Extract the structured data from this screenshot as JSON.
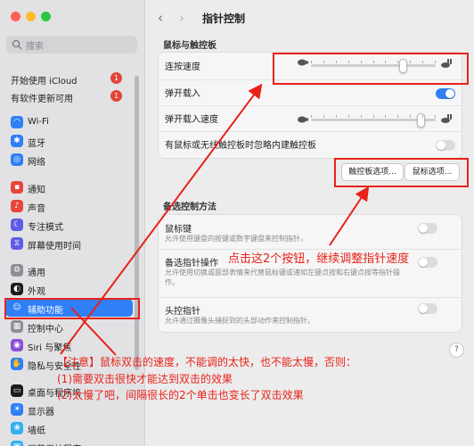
{
  "search": {
    "placeholder": "搜索"
  },
  "account": [
    {
      "label": "开始使用 iCloud",
      "badge": "1"
    },
    {
      "label": "有软件更新可用",
      "badge": "1"
    }
  ],
  "sidebar": {
    "items": [
      {
        "label": "Wi-Fi",
        "color": "#2f7ff6",
        "glyph": "◠"
      },
      {
        "label": "蓝牙",
        "color": "#2f7ff6",
        "glyph": "✱"
      },
      {
        "label": "网络",
        "color": "#2f7ff6",
        "glyph": "◎"
      },
      {
        "label": "通知",
        "color": "#e8453b",
        "glyph": "▪"
      },
      {
        "label": "声音",
        "color": "#e8453b",
        "glyph": "♪"
      },
      {
        "label": "专注模式",
        "color": "#5e5ce6",
        "glyph": "☾"
      },
      {
        "label": "屏幕使用时间",
        "color": "#5e5ce6",
        "glyph": "⧖"
      },
      {
        "label": "通用",
        "color": "#8e8e93",
        "glyph": "⚙"
      },
      {
        "label": "外观",
        "color": "#1c1c1e",
        "glyph": "◐"
      },
      {
        "label": "辅助功能",
        "color": "#2f7ff6",
        "glyph": "☺"
      },
      {
        "label": "控制中心",
        "color": "#8e8e93",
        "glyph": "▦"
      },
      {
        "label": "Siri 与聚焦",
        "color": "#8a4fd8",
        "glyph": "◉"
      },
      {
        "label": "隐私与安全性",
        "color": "#2f7ff6",
        "glyph": "✋"
      },
      {
        "label": "桌面与程序坞",
        "color": "#1c1c1e",
        "glyph": "▭"
      },
      {
        "label": "显示器",
        "color": "#2f7ff6",
        "glyph": "☀"
      },
      {
        "label": "墙纸",
        "color": "#30b0f0",
        "glyph": "❀"
      },
      {
        "label": "屏幕保护程序",
        "color": "#30b0f0",
        "glyph": "▣"
      }
    ],
    "selected_index": 9
  },
  "main": {
    "title": "指针控制",
    "section1": "鼠标与触控板",
    "rows1": {
      "double_click_speed": "连按速度",
      "spring_loading": "弹开载入",
      "spring_loading_speed": "弹开载入速度",
      "ignore_trackpad": "有鼠标或无线触控板时忽略内建触控板"
    },
    "buttons": {
      "trackpad_options": "触控板选项...",
      "mouse_options": "鼠标选项..."
    },
    "section2": "备选控制方法",
    "rows2": [
      {
        "label": "鼠标键",
        "desc": "允许使用键盘的按键或数字键盘来控制指针。"
      },
      {
        "label": "备选指针操作",
        "desc": "允许使用切换或面部表情来代替鼠标键或诸如左键点按和右键点按等指针操作。"
      },
      {
        "label": "头控指针",
        "desc": "允许通过摄像头捕捉到的头部动作来控制指针。"
      }
    ],
    "help": "?",
    "toggles": {
      "spring_loading": true,
      "ignore_trackpad": false,
      "mouse_keys": false,
      "alt_pointer": false,
      "head_pointer": false
    },
    "sliders": {
      "double_click_speed": 0.75,
      "spring_loading_speed": 0.9
    }
  },
  "annotations": {
    "buttons_note": "点击这2个按钮，继续调整指针速度",
    "note_line1": "【注意】鼠标双击的速度，不能调的太快，也不能太慢，否则：",
    "note_line2": "(1)需要双击很快才能达到双击的效果",
    "note_line3": "(2)太慢了吧，间隔很长的2个单击也变长了双击效果",
    "red": "#e8221a"
  }
}
